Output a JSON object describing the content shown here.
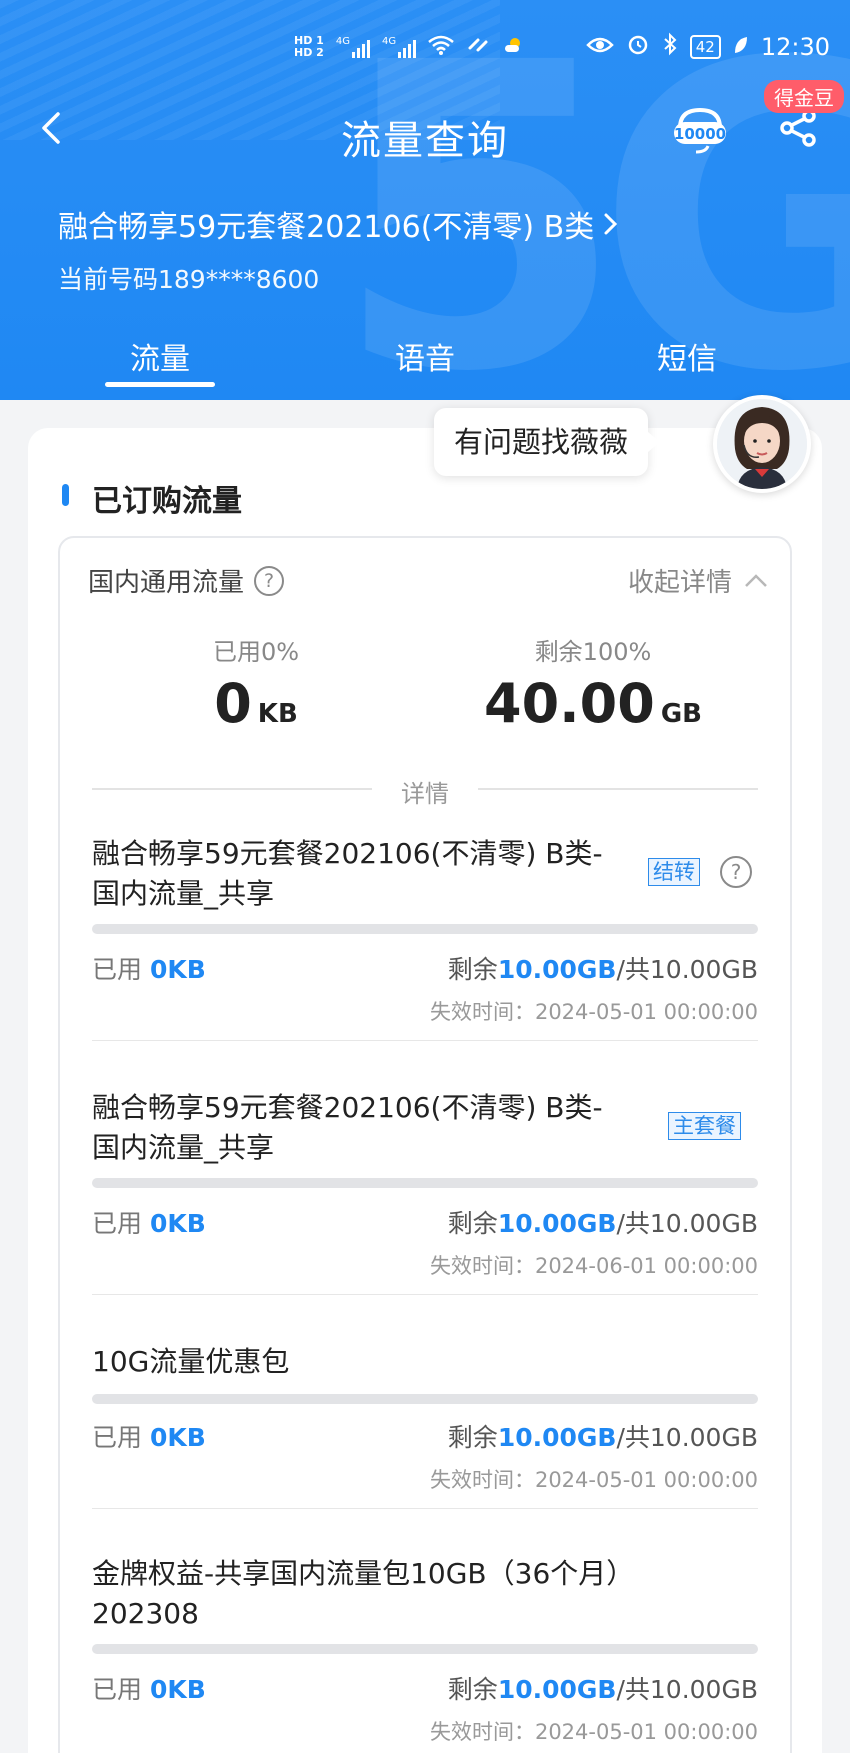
{
  "status": {
    "hd1": "HD 1",
    "hd2": "HD 2",
    "net1": "4G",
    "net2": "4G",
    "net3": "6",
    "battery": "42",
    "time": "12:30"
  },
  "header": {
    "title": "流量查询",
    "service_label": "10000",
    "gold_badge": "得金豆",
    "plan_name": "融合畅享59元套餐202106(不清零) B类",
    "phone": "当前号码189****8600",
    "tabs": [
      "流量",
      "语音",
      "短信"
    ]
  },
  "assistant": {
    "bubble": "有问题找薇薇"
  },
  "section": {
    "title": "已订购流量"
  },
  "summary": {
    "title": "国内通用流量",
    "collapse": "收起详情",
    "used_label": "已用0%",
    "used_value": "0",
    "used_unit": "KB",
    "remain_label": "剩余100%",
    "remain_value": "40.00",
    "remain_unit": "GB",
    "details_label": "详情"
  },
  "packages": [
    {
      "name": "融合畅享59元套餐202106(不清零) B类-国内流量_共享",
      "tag": "结转",
      "used_prefix": "已用 ",
      "used": "0KB",
      "remain_prefix": "剩余",
      "remain": "10.00GB",
      "total": "/共10.00GB",
      "expire": "失效时间：2024-05-01 00:00:00",
      "fraction_used": 0
    },
    {
      "name": "融合畅享59元套餐202106(不清零) B类-国内流量_共享",
      "tag": "主套餐",
      "used_prefix": "已用 ",
      "used": "0KB",
      "remain_prefix": "剩余",
      "remain": "10.00GB",
      "total": "/共10.00GB",
      "expire": "失效时间：2024-06-01 00:00:00",
      "fraction_used": 0
    },
    {
      "name": "10G流量优惠包",
      "tag": "",
      "used_prefix": "已用 ",
      "used": "0KB",
      "remain_prefix": "剩余",
      "remain": "10.00GB",
      "total": "/共10.00GB",
      "expire": "失效时间：2024-05-01 00:00:00",
      "fraction_used": 0
    },
    {
      "name": "金牌权益-共享国内流量包10GB（36个月）202308",
      "tag": "",
      "used_prefix": "已用 ",
      "used": "0KB",
      "remain_prefix": "剩余",
      "remain": "10.00GB",
      "total": "/共10.00GB",
      "expire": "失效时间：2024-05-01 00:00:00",
      "fraction_used": 0
    }
  ],
  "colors": {
    "brand": "#1f88f3",
    "tag_red": "#ff5d6a"
  }
}
